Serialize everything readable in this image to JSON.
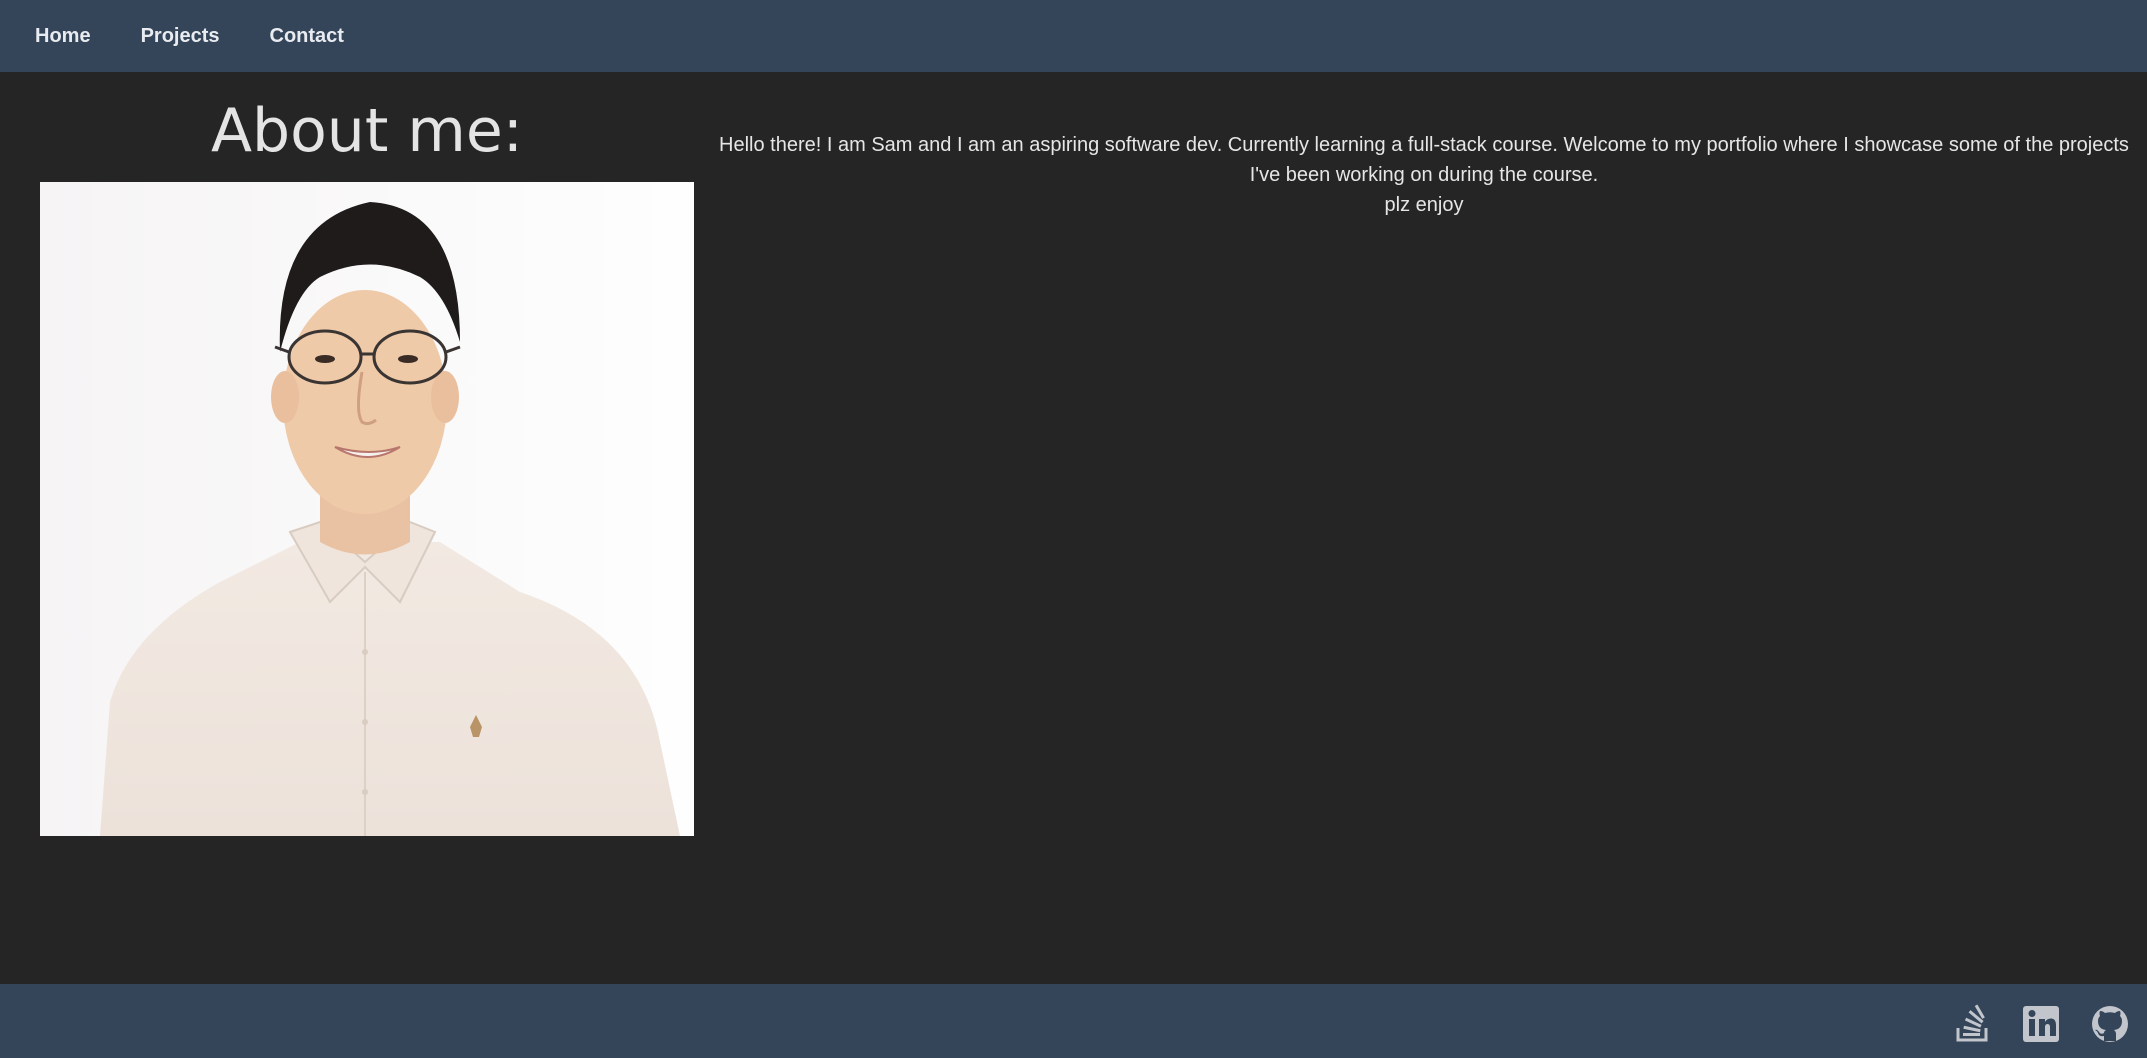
{
  "nav": {
    "items": [
      {
        "label": "Home"
      },
      {
        "label": "Projects"
      },
      {
        "label": "Contact"
      }
    ]
  },
  "about": {
    "title": "About me:",
    "intro_line1": "Hello there! I am Sam and I am an aspiring software dev. Currently learning a full-stack course. Welcome to my portfolio where I showcase some of the projects I've been working on during the course.",
    "intro_line2": "plz enjoy"
  },
  "footer": {
    "icons": [
      "stackoverflow-icon",
      "linkedin-icon",
      "github-icon"
    ]
  },
  "colors": {
    "nav_bg": "#344459",
    "page_bg": "#252525",
    "text": "#e6e6e6"
  }
}
